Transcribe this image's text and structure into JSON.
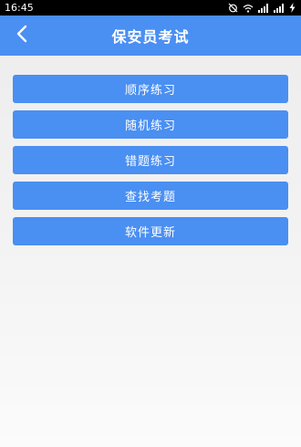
{
  "status_bar": {
    "time": "16:45",
    "icons": [
      "alarm-off-icon",
      "wifi-icon",
      "signal-icon",
      "signal-icon",
      "battery-charging-icon"
    ]
  },
  "header": {
    "title": "保安员考试",
    "back_icon": "chevron-left-icon"
  },
  "menu": {
    "items": [
      {
        "label": "顺序练习"
      },
      {
        "label": "随机练习"
      },
      {
        "label": "错题练习"
      },
      {
        "label": "查找考题"
      },
      {
        "label": "软件更新"
      }
    ]
  },
  "colors": {
    "accent": "#4a8ff2",
    "status_bar": "#000000",
    "background": "#f2f2f2"
  }
}
